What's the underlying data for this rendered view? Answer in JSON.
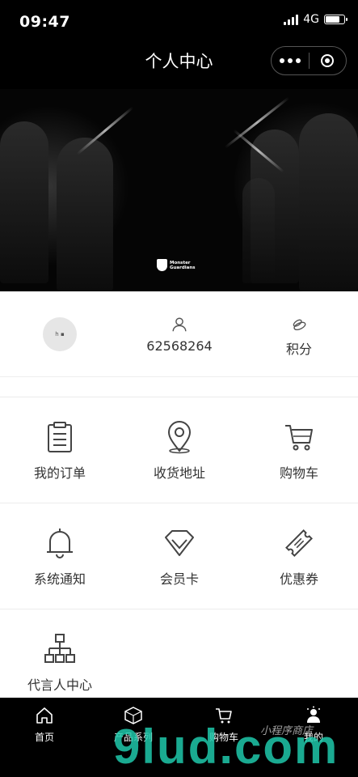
{
  "status": {
    "time": "09:47",
    "network": "4G"
  },
  "nav": {
    "title": "个人中心"
  },
  "banner": {
    "logo_text_1": "Monster",
    "logo_text_2": "Guardians"
  },
  "profile": {
    "user_id": "62568264",
    "points_label": "积分"
  },
  "menu": {
    "orders": "我的订单",
    "address": "收货地址",
    "cart": "购物车",
    "notifications": "系统通知",
    "member_card": "会员卡",
    "coupons": "优惠券",
    "ambassador": "代言人中心"
  },
  "tabbar": {
    "home": "首页",
    "products": "产品系列",
    "cart": "购物车",
    "mine": "我的"
  },
  "watermark": {
    "text": "9lud.com",
    "small": "小程序商店"
  },
  "colors": {
    "topbar": "#000000",
    "tabbar": "#000000",
    "watermark": "#1ec8aa"
  }
}
